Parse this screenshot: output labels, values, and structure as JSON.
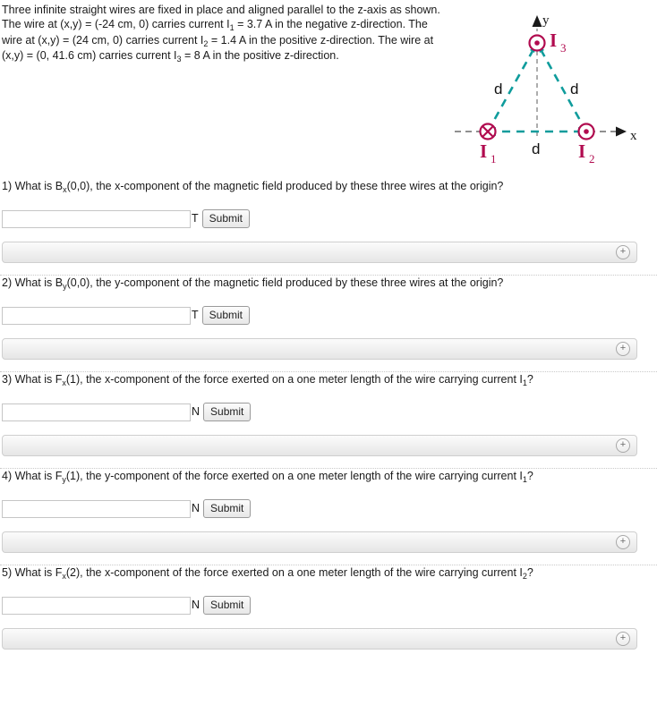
{
  "problem": {
    "statement_segments": [
      {
        "t": "Three infinite straight wires are fixed in place and aligned parallel to the z-axis as shown. The wire at (x,y) = (-24 cm, 0) carries current I"
      },
      {
        "t": "1",
        "sub": true
      },
      {
        "t": " = 3.7 A in the negative z-direction. The wire at (x,y) = (24 cm, 0) carries current I"
      },
      {
        "t": "2",
        "sub": true
      },
      {
        "t": " = 1.4 A in the positive z-direction. The wire at (x,y) = (0, 41.6 cm) carries current I"
      },
      {
        "t": "3",
        "sub": true
      },
      {
        "t": " = 8 A in the positive z-direction."
      }
    ],
    "full_text": "Three infinite straight wires are fixed in place and aligned parallel to the z-axis as shown. The wire at (x,y) = (-24 cm, 0) carries current I1 = 3.7 A in the negative z-direction. The wire at (x,y) = (24 cm, 0) carries current I2 = 1.4 A in the positive z-direction. The wire at (x,y) = (0, 41.6 cm) carries current I3 = 8 A in the positive z-direction."
  },
  "figure": {
    "axis_label_x": "x",
    "axis_label_y": "y",
    "wire1_label": "I",
    "wire1_sub": "1",
    "wire2_label": "I",
    "wire2_sub": "2",
    "wire3_label": "I",
    "wire3_sub": "3",
    "side_label_left": "d",
    "side_label_right": "d",
    "side_label_bottom": "d",
    "wire1_direction": "into-page",
    "wire2_direction": "out-of-page",
    "wire3_direction": "out-of-page",
    "colors": {
      "wire_symbol": "#b10b4f",
      "triangle": "#0f9c9c",
      "axis": "#7a7a7a",
      "label_text": "#000000"
    }
  },
  "questions": [
    {
      "number": "1)",
      "segments": [
        {
          "t": "What is B"
        },
        {
          "t": "x",
          "sub": true
        },
        {
          "t": "(0,0), the x-component of the magnetic field produced by these three wires at the origin?"
        }
      ],
      "value": "",
      "placeholder": "",
      "unit": "T",
      "submit_label": "Submit",
      "expand_icon": "+"
    },
    {
      "number": "2)",
      "segments": [
        {
          "t": "What is B"
        },
        {
          "t": "y",
          "sub": true
        },
        {
          "t": "(0,0), the y-component of the magnetic field produced by these three wires at the origin?"
        }
      ],
      "value": "",
      "placeholder": "",
      "unit": "T",
      "submit_label": "Submit",
      "expand_icon": "+"
    },
    {
      "number": "3)",
      "segments": [
        {
          "t": "What is F"
        },
        {
          "t": "x",
          "sub": true
        },
        {
          "t": "(1), the x-component of the force exerted on a one meter length of the wire carrying current I"
        },
        {
          "t": "1",
          "sub": true
        },
        {
          "t": "?"
        }
      ],
      "value": "",
      "placeholder": "",
      "unit": "N",
      "submit_label": "Submit",
      "expand_icon": "+"
    },
    {
      "number": "4)",
      "segments": [
        {
          "t": "What is F"
        },
        {
          "t": "y",
          "sub": true
        },
        {
          "t": "(1), the y-component of the force exerted on a one meter length of the wire carrying current I"
        },
        {
          "t": "1",
          "sub": true
        },
        {
          "t": "?"
        }
      ],
      "value": "",
      "placeholder": "",
      "unit": "N",
      "submit_label": "Submit",
      "expand_icon": "+"
    },
    {
      "number": "5)",
      "segments": [
        {
          "t": "What is F"
        },
        {
          "t": "x",
          "sub": true
        },
        {
          "t": "(2), the x-component of the force exerted on a one meter length of the wire carrying current I"
        },
        {
          "t": "2",
          "sub": true
        },
        {
          "t": "?"
        }
      ],
      "value": "",
      "placeholder": "",
      "unit": "N",
      "submit_label": "Submit",
      "expand_icon": "+"
    }
  ]
}
